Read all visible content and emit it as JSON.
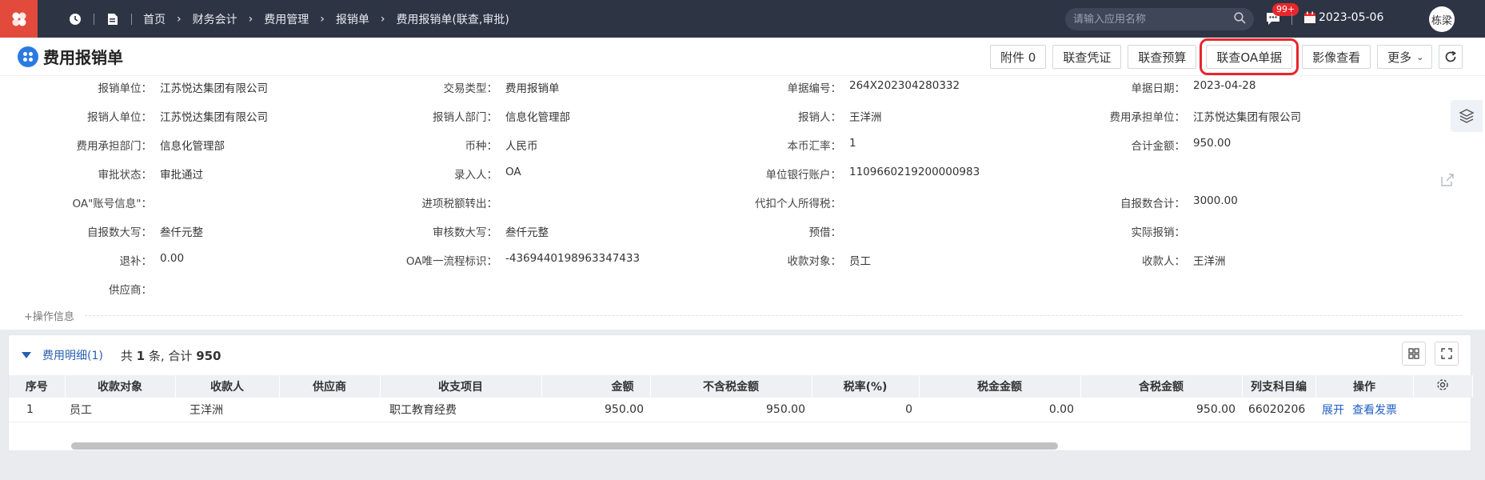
{
  "topbar": {
    "breadcrumbs": [
      "首页",
      "财务会计",
      "费用管理",
      "报销单",
      "费用报销单(联查,审批)"
    ],
    "search_placeholder": "请输入应用名称",
    "message_badge": "99+",
    "date": "2023-05-06",
    "user": "栋梁"
  },
  "header": {
    "title": "费用报销单",
    "buttons": [
      "附件 0",
      "联查凭证",
      "联查预算",
      "联查OA单据",
      "影像查看",
      "更多"
    ]
  },
  "fields": [
    {
      "label": "报销单位：",
      "value": "江苏悦达集团有限公司"
    },
    {
      "label": "交易类型：",
      "value": "费用报销单"
    },
    {
      "label": "单据编号：",
      "value": "264X202304280332"
    },
    {
      "label": "单据日期：",
      "value": "2023-04-28"
    },
    {
      "label": "报销人单位：",
      "value": "江苏悦达集团有限公司"
    },
    {
      "label": "报销人部门：",
      "value": "信息化管理部"
    },
    {
      "label": "报销人：",
      "value": "王洋洲"
    },
    {
      "label": "费用承担单位：",
      "value": "江苏悦达集团有限公司"
    },
    {
      "label": "费用承担部门：",
      "value": "信息化管理部"
    },
    {
      "label": "币种：",
      "value": "人民币"
    },
    {
      "label": "本币汇率：",
      "value": "1"
    },
    {
      "label": "合计金额：",
      "value": "950.00"
    },
    {
      "label": "审批状态：",
      "value": "审批通过"
    },
    {
      "label": "录入人：",
      "value": "OA"
    },
    {
      "label": "单位银行账户：",
      "value": "1109660219200000983"
    },
    {
      "label": "",
      "value": ""
    },
    {
      "label": "OA\"账号信息\"：",
      "value": ""
    },
    {
      "label": "进项税额转出：",
      "value": ""
    },
    {
      "label": "代扣个人所得税：",
      "value": ""
    },
    {
      "label": "自报数合计：",
      "value": "3000.00"
    },
    {
      "label": "自报数大写：",
      "value": "叁仟元整"
    },
    {
      "label": "审核数大写：",
      "value": "叁仟元整"
    },
    {
      "label": "预借：",
      "value": ""
    },
    {
      "label": "实际报销：",
      "value": ""
    },
    {
      "label": "退补：",
      "value": "0.00"
    },
    {
      "label": "OA唯一流程标识：",
      "value": "-4369440198963347433"
    },
    {
      "label": "收款对象：",
      "value": "员工"
    },
    {
      "label": "收款人：",
      "value": "王洋洲"
    },
    {
      "label": "供应商：",
      "value": ""
    }
  ],
  "op_info": "+操作信息",
  "detail": {
    "title": "费用明细(1)",
    "count_prefix": "共",
    "count": "1",
    "count_mid": "条, 合计",
    "total": "950",
    "columns": [
      "序号",
      "收款对象",
      "收款人",
      "供应商",
      "收支项目",
      "金额",
      "不含税金额",
      "税率(%)",
      "税金金额",
      "含税金额",
      "列支科目编",
      "操作"
    ],
    "rows": [
      {
        "no": "1",
        "payee_type": "员工",
        "payee": "王洋洲",
        "supplier": "",
        "item": "职工教育经费",
        "amount": "950.00",
        "amount_ex_tax": "950.00",
        "tax_rate": "0",
        "tax": "0.00",
        "amount_inc_tax": "950.00",
        "account_code": "66020206",
        "op_expand": "展开",
        "op_invoice": "查看发票"
      }
    ]
  }
}
